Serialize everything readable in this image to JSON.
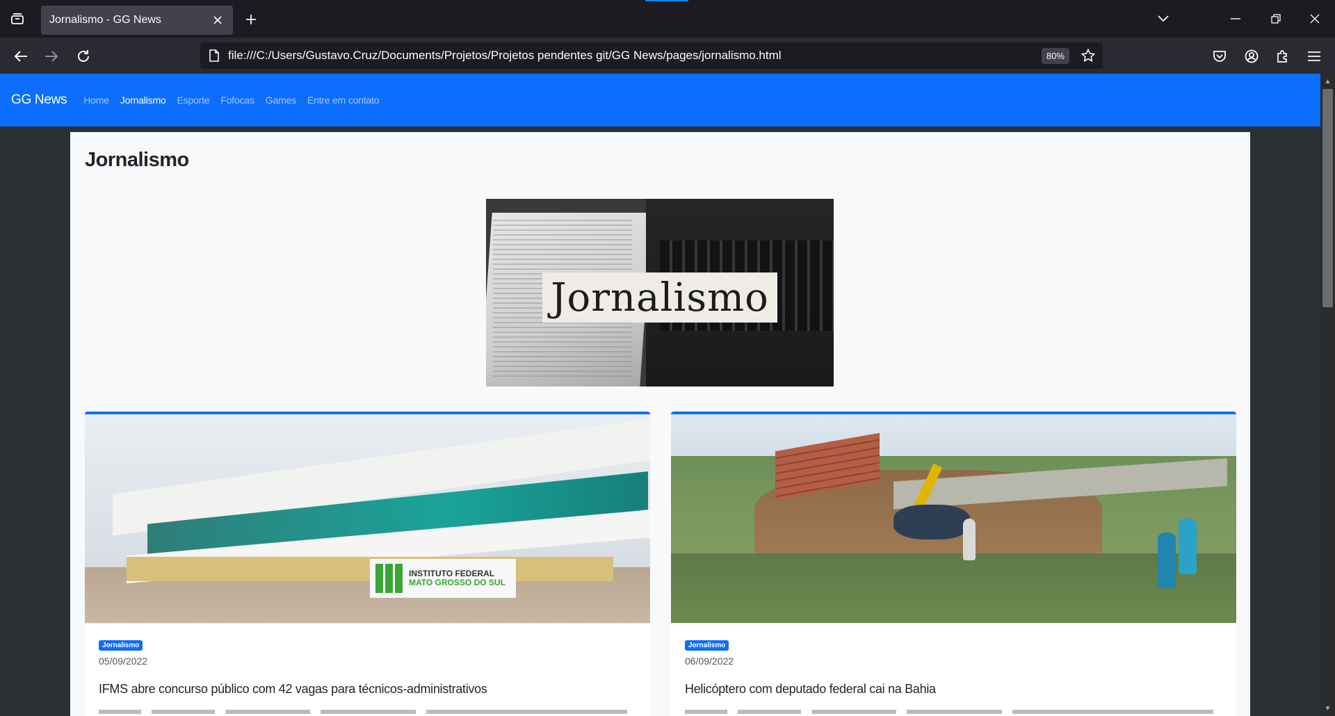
{
  "browser": {
    "tab_title": "Jornalismo - GG News",
    "url": "file:///C:/Users/Gustavo.Cruz/Documents/Projetos/Projetos pendentes git/GG News/pages/jornalismo.html",
    "zoom": "80%"
  },
  "site": {
    "brand": "GG News",
    "nav": [
      {
        "label": "Home",
        "active": false
      },
      {
        "label": "Jornalismo",
        "active": true
      },
      {
        "label": "Esporte",
        "active": false
      },
      {
        "label": "Fofocas",
        "active": false
      },
      {
        "label": "Games",
        "active": false
      },
      {
        "label": "Entre em contato",
        "active": false
      }
    ],
    "accent": "#0d6efd"
  },
  "page": {
    "title": "Jornalismo",
    "hero_text": "Jornalismo"
  },
  "cards": [
    {
      "badge": "Jornalismo",
      "date": "05/09/2022",
      "title": "IFMS abre concurso público com 42 vagas para técnicos-administrativos",
      "sign_line1": "INSTITUTO FEDERAL",
      "sign_line2": "MATO GROSSO DO SUL"
    },
    {
      "badge": "Jornalismo",
      "date": "06/09/2022",
      "title": "Helicóptero com deputado federal cai na Bahia"
    }
  ],
  "icons": {
    "tab_list": "tab-list-icon",
    "close": "close-icon",
    "new_tab": "plus-icon",
    "back": "arrow-left-icon",
    "forward": "arrow-right-icon",
    "reload": "reload-icon",
    "page": "page-icon",
    "bookmark": "star-icon",
    "pocket": "pocket-icon",
    "account": "account-icon",
    "extensions": "puzzle-icon",
    "menu": "hamburger-icon"
  }
}
